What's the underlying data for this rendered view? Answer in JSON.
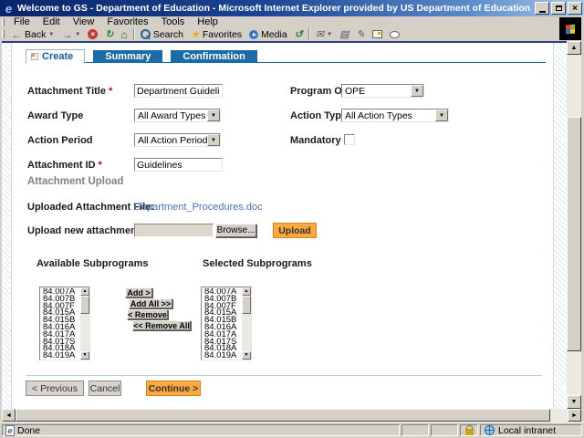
{
  "window": {
    "title": "Welcome to GS - Department of Education - Microsoft Internet Explorer provided by US Department of Education",
    "menu": [
      "File",
      "Edit",
      "View",
      "Favorites",
      "Tools",
      "Help"
    ],
    "toolbar": {
      "back": "Back",
      "search": "Search",
      "favorites": "Favorites",
      "media": "Media"
    },
    "statusbar": {
      "status": "Done",
      "zone": "Local intranet"
    }
  },
  "tabs": [
    {
      "label": "Create"
    },
    {
      "label": "Summary"
    },
    {
      "label": "Confirmation"
    }
  ],
  "required_marker": "*",
  "fields": {
    "attachment_title": {
      "label": "Attachment Title",
      "value": "Department Guidelines",
      "required": true
    },
    "program_office": {
      "label": "Program Office",
      "value": "OPE"
    },
    "award_type": {
      "label": "Award Type",
      "value": "All Award Types"
    },
    "action_type": {
      "label": "Action Type",
      "value": "All Action Types"
    },
    "action_period": {
      "label": "Action Period",
      "value": "All Action Periods"
    },
    "mandatory": {
      "label": "Mandatory",
      "checked": false
    },
    "attachment_id": {
      "label": "Attachment ID",
      "value": "Guidelines",
      "required": true
    }
  },
  "upload": {
    "heading": "Attachment Upload",
    "uploaded_label": "Uploaded Attachment File:",
    "uploaded_file": "Department_Procedures.doc",
    "new_label": "Upload new attachment file",
    "browse": "Browse...",
    "upload": "Upload"
  },
  "subprograms": {
    "available_label": "Available Subprograms",
    "selected_label": "Selected Subprograms",
    "available": [
      "84.007A",
      "84.007B",
      "84.007F",
      "84.015A",
      "84.015B",
      "84.016A",
      "84.017A",
      "84.017S",
      "84.018A",
      "84.019A"
    ],
    "selected": [
      "84.007A",
      "84.007B",
      "84.007F",
      "84.015A",
      "84.015B",
      "84.016A",
      "84.017A",
      "84.017S",
      "84.018A",
      "84.019A"
    ],
    "add": "Add >",
    "add_all": "Add All >>",
    "remove": "< Remove",
    "remove_all": "<< Remove All"
  },
  "footer": {
    "previous": "< Previous",
    "cancel": "Cancel",
    "continue": "Continue >"
  },
  "icons": {
    "dropdown_arrow": "▼",
    "back_arrow": "←",
    "forward_arrow": "→",
    "stop_glyph": "×",
    "refresh_glyph": "↻",
    "home_glyph": "⌂",
    "favorites_star": "★",
    "history_glyph": "↺",
    "mail_glyph": "✉",
    "print_glyph": "▤",
    "edit_glyph": "✎",
    "scroll_up": "▲",
    "scroll_down": "▼",
    "scroll_left": "◄",
    "scroll_right": "►",
    "close_glyph": "×",
    "ie_e": "e"
  },
  "colors": {
    "accent_orange": "#FBA93F",
    "tab_blue": "#1A6BA8",
    "link_blue": "#4A72B8",
    "required_red": "#CC0000",
    "titlebar_start": "#0A246A",
    "titlebar_end": "#A6CAF0"
  }
}
